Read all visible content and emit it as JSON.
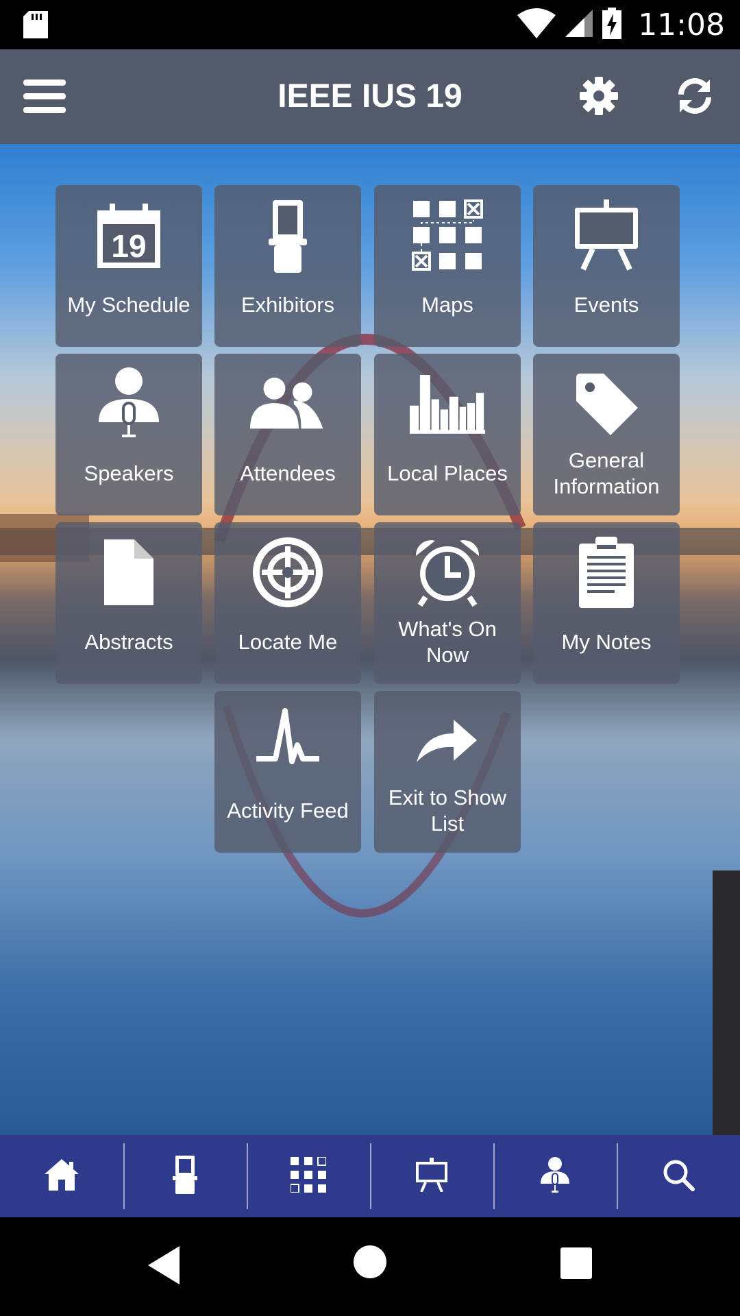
{
  "status_bar": {
    "time": "11:08"
  },
  "app_bar": {
    "title": "IEEE IUS 19"
  },
  "tiles": [
    {
      "label": "My Schedule",
      "icon": "calendar-icon",
      "calendar_day": "19"
    },
    {
      "label": "Exhibitors",
      "icon": "booth-icon"
    },
    {
      "label": "Maps",
      "icon": "floorplan-icon"
    },
    {
      "label": "Events",
      "icon": "easel-icon"
    },
    {
      "label": "Speakers",
      "icon": "speaker-icon"
    },
    {
      "label": "Attendees",
      "icon": "attendees-icon"
    },
    {
      "label": "Local Places",
      "icon": "city-icon"
    },
    {
      "label": "General Information",
      "icon": "tag-icon"
    },
    {
      "label": "Abstracts",
      "icon": "document-icon"
    },
    {
      "label": "Locate Me",
      "icon": "target-icon"
    },
    {
      "label": "What's On Now",
      "icon": "alarm-clock-icon"
    },
    {
      "label": "My Notes",
      "icon": "clipboard-icon"
    },
    {
      "label": "Activity Feed",
      "icon": "pulse-icon"
    },
    {
      "label": "Exit to Show List",
      "icon": "share-arrow-icon"
    }
  ],
  "bottom_nav": [
    "home-icon",
    "booth-icon",
    "floorplan-icon",
    "easel-icon",
    "speaker-icon",
    "search-icon"
  ],
  "colors": {
    "app_bar": "#535b6b",
    "bottom_nav": "#2e3a8c",
    "tile": "#555c6c"
  }
}
